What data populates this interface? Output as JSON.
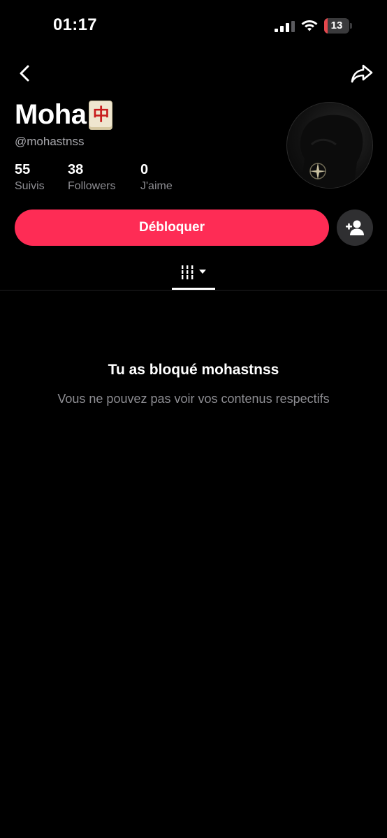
{
  "status_bar": {
    "time": "01:17",
    "battery_level": "13",
    "battery_fill_fraction": 0.13
  },
  "top_bar": {
    "back_icon": "chevron-left-icon",
    "share_icon": "share-arrow-icon"
  },
  "profile": {
    "display_name": "Moha",
    "emoji": "🀄",
    "username": "@mohastnss",
    "stats": [
      {
        "value": "55",
        "label": "Suivis"
      },
      {
        "value": "38",
        "label": "Followers"
      },
      {
        "value": "0",
        "label": "J'aime"
      }
    ],
    "unblock_label": "Débloquer",
    "add_friend_icon": "add-friend-icon"
  },
  "tabs": {
    "videos_icon": "videos-grid-icon",
    "dropdown_icon": "caret-down-icon"
  },
  "empty_state": {
    "title": "Tu as bloqué mohastnss",
    "subtitle": "Vous ne pouvez pas voir vos contenus respectifs"
  },
  "colors": {
    "background": "#000000",
    "accent": "#fe2c55",
    "secondary_text": "#8e8e93",
    "battery_low": "#e5484d"
  }
}
